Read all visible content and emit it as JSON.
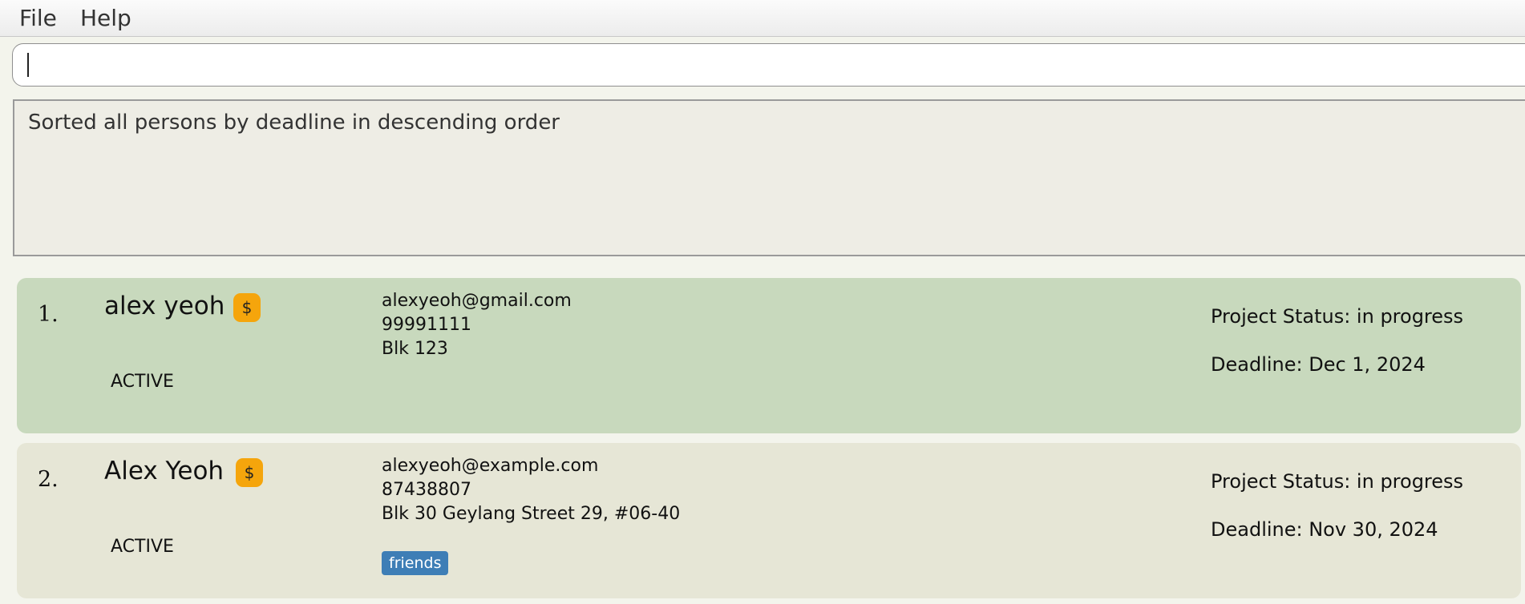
{
  "menu": {
    "file": "File",
    "help": "Help"
  },
  "command": {
    "value": ""
  },
  "result": {
    "message": "Sorted all persons by deadline in descending order"
  },
  "persons": [
    {
      "index": "1.",
      "name": "alex yeoh",
      "badge": "$",
      "email": "alexyeoh@gmail.com",
      "phone": "99991111",
      "address": "Blk 123",
      "status": "ACTIVE",
      "project_status": "Project Status: in progress",
      "deadline": "Deadline: Dec 1, 2024",
      "tags": []
    },
    {
      "index": "2.",
      "name": "Alex Yeoh",
      "badge": "$",
      "email": "alexyeoh@example.com",
      "phone": "87438807",
      "address": "Blk 30 Geylang Street 29, #06-40",
      "status": "ACTIVE",
      "project_status": "Project Status: in progress",
      "deadline": "Deadline: Nov 30, 2024",
      "tags": [
        "friends"
      ]
    }
  ],
  "colors": {
    "selected_card": "#c8d9bd",
    "card": "#e6e6d6",
    "badge": "#f5a50c",
    "tag": "#3e7eb6"
  }
}
